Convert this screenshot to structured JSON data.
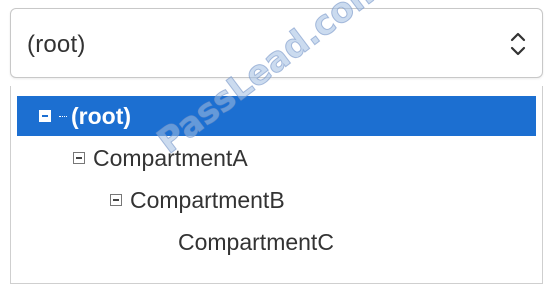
{
  "select": {
    "value": "(root)",
    "chevron_icon": "chevron-up-down-icon"
  },
  "tree": {
    "items": [
      {
        "label": "(root)",
        "level": 0,
        "expanded": true,
        "selected": true
      },
      {
        "label": "CompartmentA",
        "level": 1,
        "expanded": true,
        "selected": false
      },
      {
        "label": "CompartmentB",
        "level": 2,
        "expanded": true,
        "selected": false
      },
      {
        "label": "CompartmentC",
        "level": 3,
        "expanded": false,
        "selected": false
      }
    ]
  },
  "watermark": "PassLead.com",
  "colors": {
    "selection": "#1c6fd1",
    "text": "#333333"
  }
}
